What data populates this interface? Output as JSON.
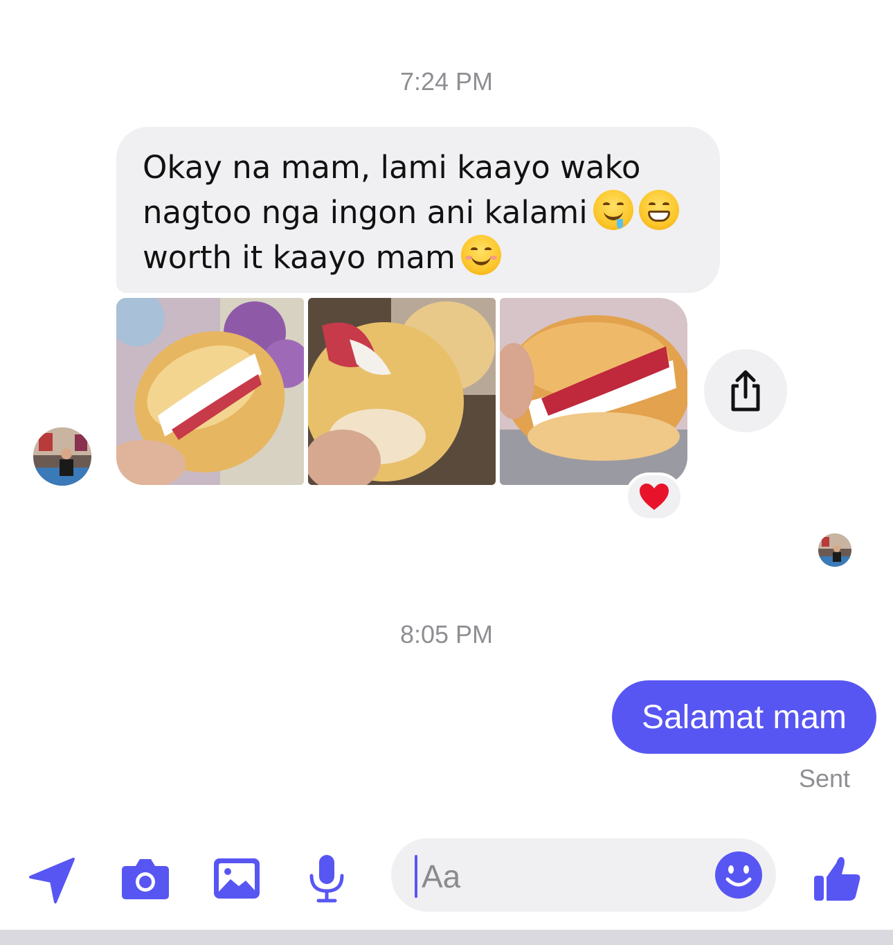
{
  "thread": {
    "timestamps": [
      "7:24 PM",
      "8:05 PM"
    ],
    "incoming": {
      "lines": [
        "Okay na mam, lami kaayo wako",
        "nagtoo nga ingon ani kalami",
        "worth it kaayo mam"
      ],
      "emojis": [
        "drooling-face",
        "grinning-face",
        "smiling-face"
      ],
      "photos": [
        "photo-1",
        "photo-2",
        "photo-3"
      ],
      "reaction": "heart"
    },
    "outgoing": {
      "text": "Salamat mam",
      "status": "Sent"
    }
  },
  "composer": {
    "placeholder": "Aa",
    "tools": [
      "send-icon",
      "camera-icon",
      "image-icon",
      "microphone-icon",
      "thumbs-up-icon"
    ]
  },
  "colors": {
    "accent": "#5856f2",
    "incoming_bubble": "#f0f0f2",
    "muted_text": "#8e8e93"
  }
}
